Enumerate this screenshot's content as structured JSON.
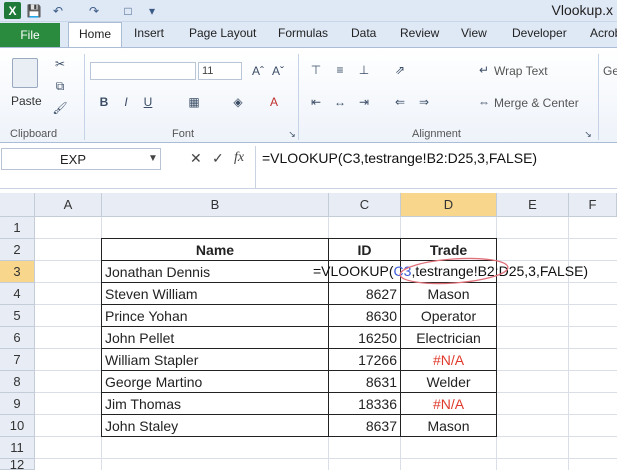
{
  "titlebar": {
    "app_logo": "X",
    "title": "Vlookup.x",
    "icons": [
      "save-icon",
      "undo-icon",
      "redo-icon",
      "new-file-icon",
      "customize-icon"
    ]
  },
  "tabs": {
    "file": "File",
    "items": [
      "Home",
      "Insert",
      "Page Layout",
      "Formulas",
      "Data",
      "Review",
      "View",
      "Developer",
      "Acrob"
    ],
    "active": "Home"
  },
  "ribbon": {
    "paste_label": "Paste",
    "clipboard_label": "Clipboard",
    "font_label": "Font",
    "alignment_label": "Alignment",
    "font_size": "11",
    "wrap_text": "Wrap Text",
    "merge_center": "Merge & Center",
    "general_partial": "Ge",
    "bold": "B",
    "italic": "I",
    "underline": "U"
  },
  "formula_bar": {
    "name_box": "EXP",
    "cancel": "✕",
    "enter": "✓",
    "fx": "fx",
    "formula": "=VLOOKUP(C3,testrange!B2:D25,3,FALSE)"
  },
  "grid": {
    "columns": [
      "A",
      "B",
      "C",
      "D",
      "E",
      "F"
    ],
    "rows": [
      "1",
      "2",
      "3",
      "4",
      "5",
      "6",
      "7",
      "8",
      "9",
      "10",
      "11",
      "12"
    ],
    "headers": {
      "name": "Name",
      "id": "ID",
      "trade": "Trade"
    },
    "active_row": "3",
    "edit_formula_pre": "=VLOOKUP(",
    "edit_formula_ref": "C3",
    "edit_formula_post": ",testrange!B2:D25,3,FALSE)",
    "data": [
      {
        "name": "Jonathan Dennis",
        "id": "",
        "trade": ""
      },
      {
        "name": "Steven William",
        "id": "8627",
        "trade": "Mason"
      },
      {
        "name": "Prince Yohan",
        "id": "8630",
        "trade": "Operator"
      },
      {
        "name": "John Pellet",
        "id": "16250",
        "trade": "Electrician"
      },
      {
        "name": "William Stapler",
        "id": "17266",
        "trade": "#N/A"
      },
      {
        "name": "George Martino",
        "id": "8631",
        "trade": "Welder"
      },
      {
        "name": "Jim Thomas",
        "id": "18336",
        "trade": "#N/A"
      },
      {
        "name": "John Staley",
        "id": "8637",
        "trade": "Mason"
      }
    ]
  },
  "colors": {
    "file_tab": "#2a8a3e",
    "selected_header": "#f8d78c",
    "error_text": "#e03a2c",
    "reference_blue": "#3b5bd6"
  }
}
